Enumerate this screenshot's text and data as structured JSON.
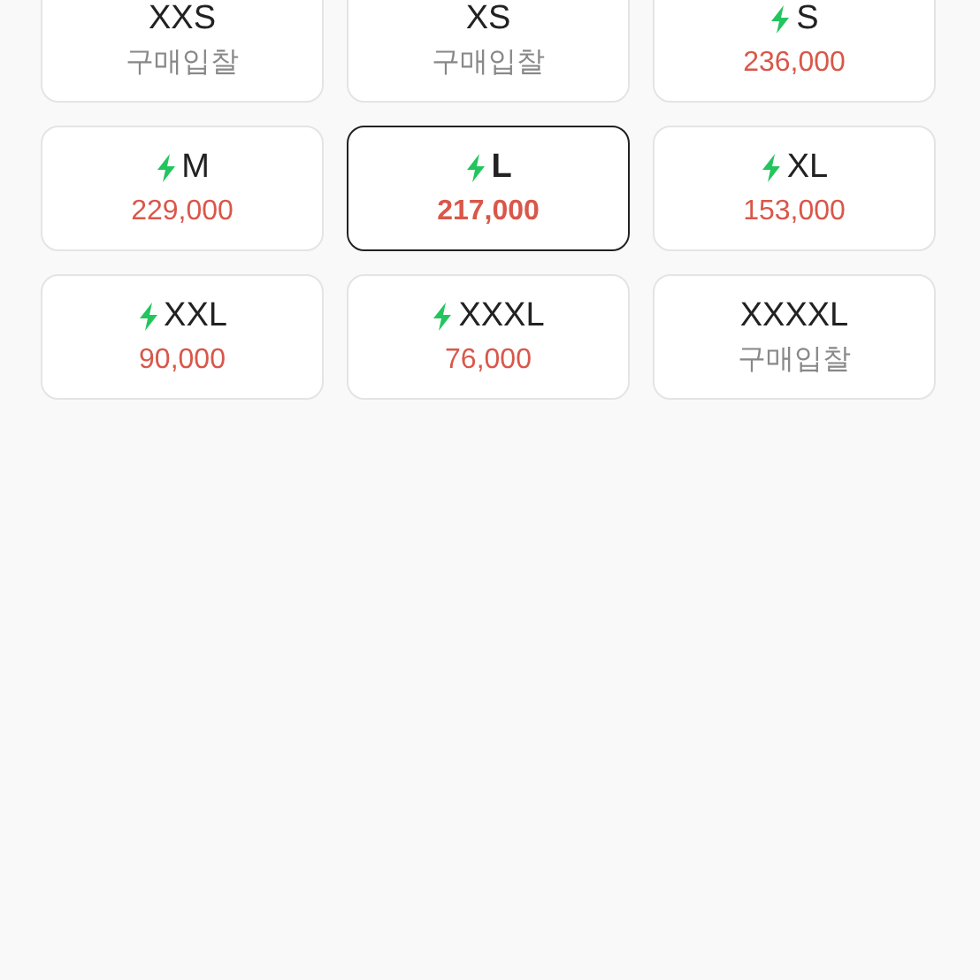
{
  "sizes": [
    {
      "label": "XXS",
      "price": "구매입찰",
      "kind": "bid",
      "fast": false,
      "selected": false
    },
    {
      "label": "XS",
      "price": "구매입찰",
      "kind": "bid",
      "fast": false,
      "selected": false
    },
    {
      "label": "S",
      "price": "236,000",
      "kind": "price",
      "fast": true,
      "selected": false
    },
    {
      "label": "M",
      "price": "229,000",
      "kind": "price",
      "fast": true,
      "selected": false
    },
    {
      "label": "L",
      "price": "217,000",
      "kind": "price",
      "fast": true,
      "selected": true
    },
    {
      "label": "XL",
      "price": "153,000",
      "kind": "price",
      "fast": true,
      "selected": false
    },
    {
      "label": "XXL",
      "price": "90,000",
      "kind": "price",
      "fast": true,
      "selected": false
    },
    {
      "label": "XXXL",
      "price": "76,000",
      "kind": "price",
      "fast": true,
      "selected": false
    },
    {
      "label": "XXXXL",
      "price": "구매입찰",
      "kind": "bid",
      "fast": false,
      "selected": false
    }
  ]
}
